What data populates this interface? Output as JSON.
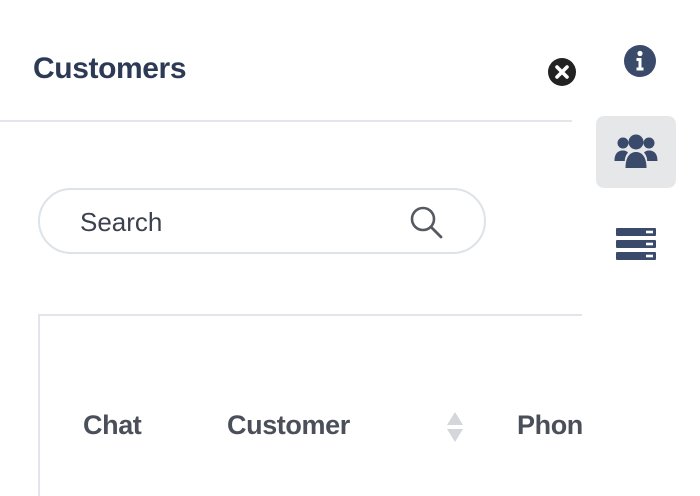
{
  "panel": {
    "title": "Customers",
    "close_icon": "close-circle-icon"
  },
  "search": {
    "placeholder": "Search",
    "value": "",
    "icon": "search-icon"
  },
  "table": {
    "columns": [
      {
        "label": "Chat",
        "sortable": false
      },
      {
        "label": "Customer",
        "sortable": true
      },
      {
        "label": "Phone",
        "sortable": false
      }
    ]
  },
  "sidebar": {
    "items": [
      {
        "icon": "info-icon",
        "active": false
      },
      {
        "icon": "users-icon",
        "active": true
      },
      {
        "icon": "database-icon",
        "active": false
      }
    ]
  },
  "colors": {
    "title": "#2d3a56",
    "icon": "#3a4a6b",
    "active_background": "#e6e7e9",
    "border": "#dde3e8"
  }
}
